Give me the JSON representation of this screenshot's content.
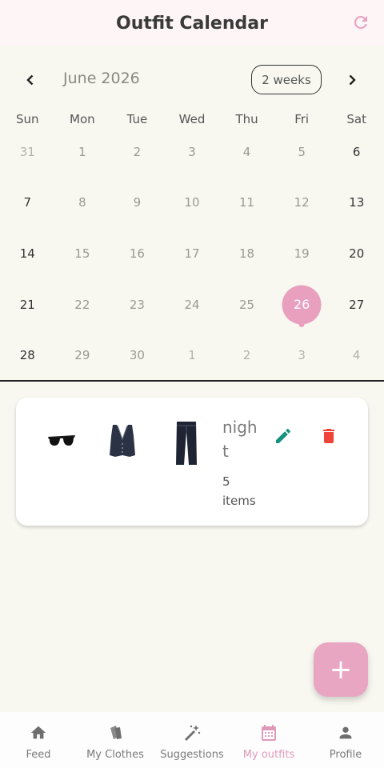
{
  "appbar": {
    "title": "Outfit Calendar",
    "refresh_icon": "refresh-icon"
  },
  "calendar": {
    "month_label": "June 2026",
    "format_label": "2 weeks",
    "weekdays": [
      "Sun",
      "Mon",
      "Tue",
      "Wed",
      "Thu",
      "Fri",
      "Sat"
    ],
    "weeks": [
      [
        "31",
        "1",
        "2",
        "3",
        "4",
        "5",
        "6"
      ],
      [
        "7",
        "8",
        "9",
        "10",
        "11",
        "12",
        "13"
      ],
      [
        "14",
        "15",
        "16",
        "17",
        "18",
        "19",
        "20"
      ],
      [
        "21",
        "22",
        "23",
        "24",
        "25",
        "26",
        "27"
      ],
      [
        "28",
        "29",
        "30",
        "1",
        "2",
        "3",
        "4"
      ]
    ],
    "selected_day": "26",
    "accent_color": "#e9a0bf"
  },
  "outfit": {
    "name": "night",
    "item_count": "5 items",
    "items": [
      "sunglasses",
      "vest",
      "jeans"
    ]
  },
  "fab": {
    "label": "+"
  },
  "bottom_nav": {
    "items": [
      {
        "label": "Feed",
        "icon": "home-icon"
      },
      {
        "label": "My Clothes",
        "icon": "clothes-icon"
      },
      {
        "label": "Suggestions",
        "icon": "magic-wand-icon"
      },
      {
        "label": "My outfits",
        "icon": "calendar-icon",
        "active": true
      },
      {
        "label": "Profile",
        "icon": "person-icon"
      }
    ]
  }
}
